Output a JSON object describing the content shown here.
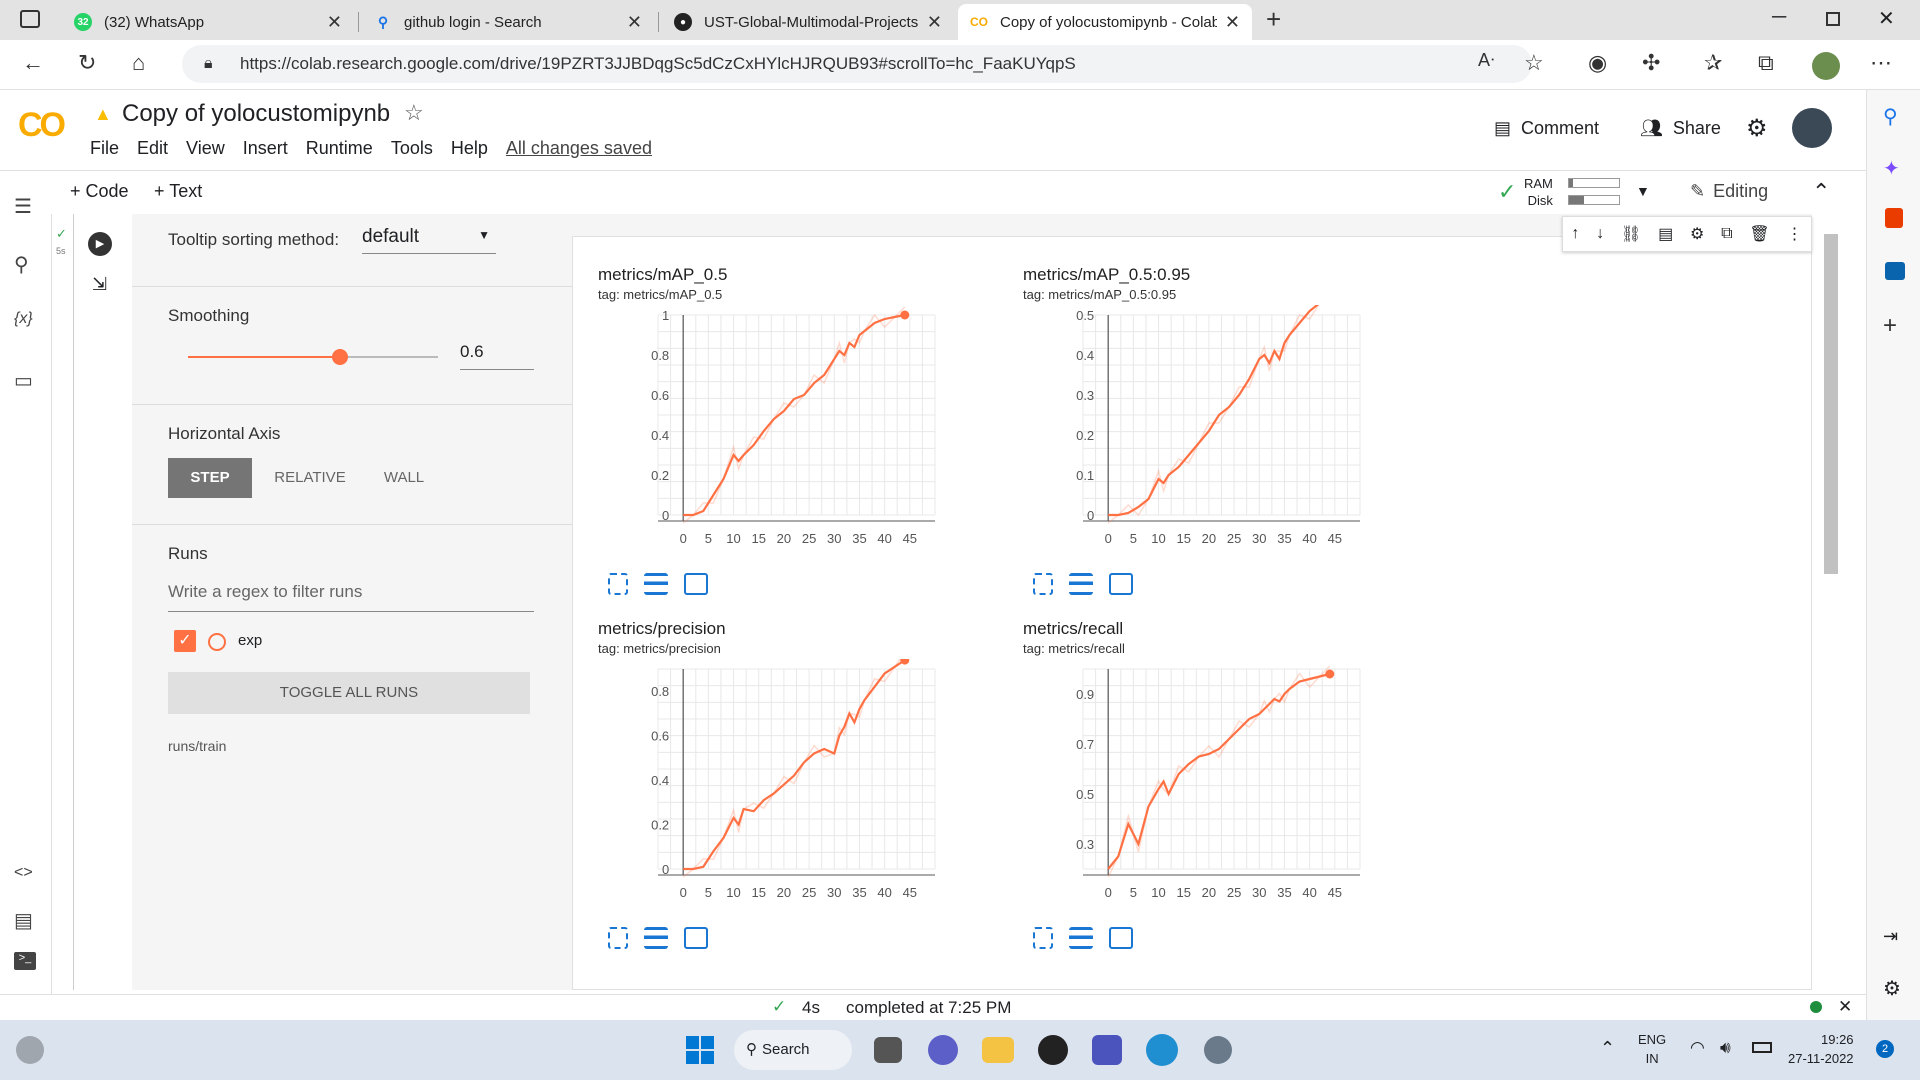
{
  "browser": {
    "tabs": [
      {
        "badge": "32",
        "title": "(32) WhatsApp"
      },
      {
        "title": "github login - Search"
      },
      {
        "title": "UST-Global-Multimodal-Projects"
      },
      {
        "title": "Copy of yolocustomipynb - Colab"
      }
    ],
    "url": "https://colab.research.google.com/drive/19PZRT3JJBDqgSc5dCzCxHYlcHJRQUB93#scrollTo=hc_FaaKUYqpS"
  },
  "colab": {
    "logo": "CO",
    "notebook_title": "Copy of yolocustomipynb",
    "menu": [
      "File",
      "Edit",
      "View",
      "Insert",
      "Runtime",
      "Tools",
      "Help"
    ],
    "saved_status": "All changes saved",
    "comment_label": "Comment",
    "share_label": "Share",
    "add_code": "+ Code",
    "add_text": "+ Text",
    "ram_label": "RAM",
    "disk_label": "Disk",
    "editing_label": "Editing",
    "exec_time": "5s"
  },
  "tensorboard": {
    "tooltip_label": "Tooltip sorting method:",
    "tooltip_value": "default",
    "smoothing_label": "Smoothing",
    "smoothing_value": "0.6",
    "smoothing_fraction": 0.6,
    "axis_label": "Horizontal Axis",
    "axis_options": [
      "STEP",
      "RELATIVE",
      "WALL"
    ],
    "runs_label": "Runs",
    "runs_placeholder": "Write a regex to filter runs",
    "run_name": "exp",
    "toggle_label": "TOGGLE ALL RUNS",
    "runs_path": "runs/train",
    "accent": "#ff7043"
  },
  "chart_data": [
    {
      "type": "line",
      "title": "metrics/mAP_0.5",
      "tag": "tag: metrics/mAP_0.5",
      "xticks": [
        0,
        5,
        10,
        15,
        20,
        25,
        30,
        35,
        40,
        45
      ],
      "yticks": [
        "0",
        "0.2",
        "0.4",
        "0.6",
        "0.8",
        "1"
      ],
      "ylim": [
        0,
        1.0
      ],
      "x": [
        0,
        2,
        4,
        6,
        8,
        10,
        11,
        12,
        14,
        16,
        18,
        20,
        22,
        24,
        26,
        28,
        30,
        31,
        32,
        33,
        34,
        35,
        36,
        38,
        40,
        42,
        44
      ],
      "y": [
        0,
        0,
        0.02,
        0.1,
        0.18,
        0.3,
        0.27,
        0.3,
        0.35,
        0.42,
        0.48,
        0.52,
        0.58,
        0.6,
        0.66,
        0.7,
        0.78,
        0.82,
        0.8,
        0.86,
        0.84,
        0.9,
        0.92,
        0.96,
        0.98,
        0.99,
        1.0
      ]
    },
    {
      "type": "line",
      "title": "metrics/mAP_0.5:0.95",
      "tag": "tag: metrics/mAP_0.5:0.95",
      "xticks": [
        0,
        5,
        10,
        15,
        20,
        25,
        30,
        35,
        40,
        45
      ],
      "yticks": [
        "0",
        "0.1",
        "0.2",
        "0.3",
        "0.4",
        "0.5"
      ],
      "ylim": [
        0,
        0.5
      ],
      "x": [
        0,
        2,
        4,
        6,
        8,
        10,
        11,
        12,
        14,
        16,
        18,
        20,
        22,
        24,
        26,
        28,
        30,
        31,
        32,
        33,
        34,
        35,
        36,
        38,
        40,
        42,
        44
      ],
      "y": [
        0,
        0,
        0.005,
        0.02,
        0.04,
        0.09,
        0.08,
        0.1,
        0.12,
        0.15,
        0.18,
        0.21,
        0.25,
        0.27,
        0.3,
        0.34,
        0.39,
        0.4,
        0.38,
        0.41,
        0.39,
        0.43,
        0.45,
        0.48,
        0.51,
        0.53,
        0.54
      ]
    },
    {
      "type": "line",
      "title": "metrics/precision",
      "tag": "tag: metrics/precision",
      "xticks": [
        0,
        5,
        10,
        15,
        20,
        25,
        30,
        35,
        40,
        45
      ],
      "yticks": [
        "0",
        "0.2",
        "0.4",
        "0.6",
        "0.8"
      ],
      "ylim": [
        0,
        0.9
      ],
      "x": [
        0,
        2,
        4,
        6,
        8,
        10,
        11,
        12,
        14,
        16,
        18,
        20,
        22,
        24,
        26,
        28,
        30,
        31,
        32,
        33,
        34,
        35,
        36,
        38,
        40,
        42,
        44
      ],
      "y": [
        0,
        0,
        0.01,
        0.08,
        0.14,
        0.23,
        0.2,
        0.27,
        0.26,
        0.31,
        0.34,
        0.38,
        0.42,
        0.48,
        0.52,
        0.54,
        0.52,
        0.6,
        0.64,
        0.7,
        0.66,
        0.72,
        0.76,
        0.82,
        0.88,
        0.91,
        0.94
      ]
    },
    {
      "type": "line",
      "title": "metrics/recall",
      "tag": "tag: metrics/recall",
      "xticks": [
        0,
        5,
        10,
        15,
        20,
        25,
        30,
        35,
        40,
        45
      ],
      "yticks": [
        "0.3",
        "0.5",
        "0.7",
        "0.9"
      ],
      "ylim": [
        0.2,
        1.0
      ],
      "x": [
        0,
        2,
        4,
        6,
        8,
        10,
        11,
        12,
        14,
        16,
        18,
        20,
        22,
        24,
        26,
        28,
        30,
        31,
        32,
        33,
        34,
        35,
        36,
        38,
        40,
        42,
        44
      ],
      "y": [
        0.2,
        0.25,
        0.38,
        0.3,
        0.45,
        0.52,
        0.55,
        0.5,
        0.58,
        0.62,
        0.65,
        0.66,
        0.68,
        0.72,
        0.76,
        0.8,
        0.82,
        0.84,
        0.86,
        0.88,
        0.87,
        0.9,
        0.92,
        0.95,
        0.96,
        0.97,
        0.98
      ]
    }
  ],
  "status": {
    "duration": "4s",
    "completed": "completed at 7:25 PM"
  },
  "taskbar": {
    "search_label": "Search",
    "lang_top": "ENG",
    "lang_bottom": "IN",
    "time": "19:26",
    "date": "27-11-2022",
    "notif_count": "2"
  }
}
